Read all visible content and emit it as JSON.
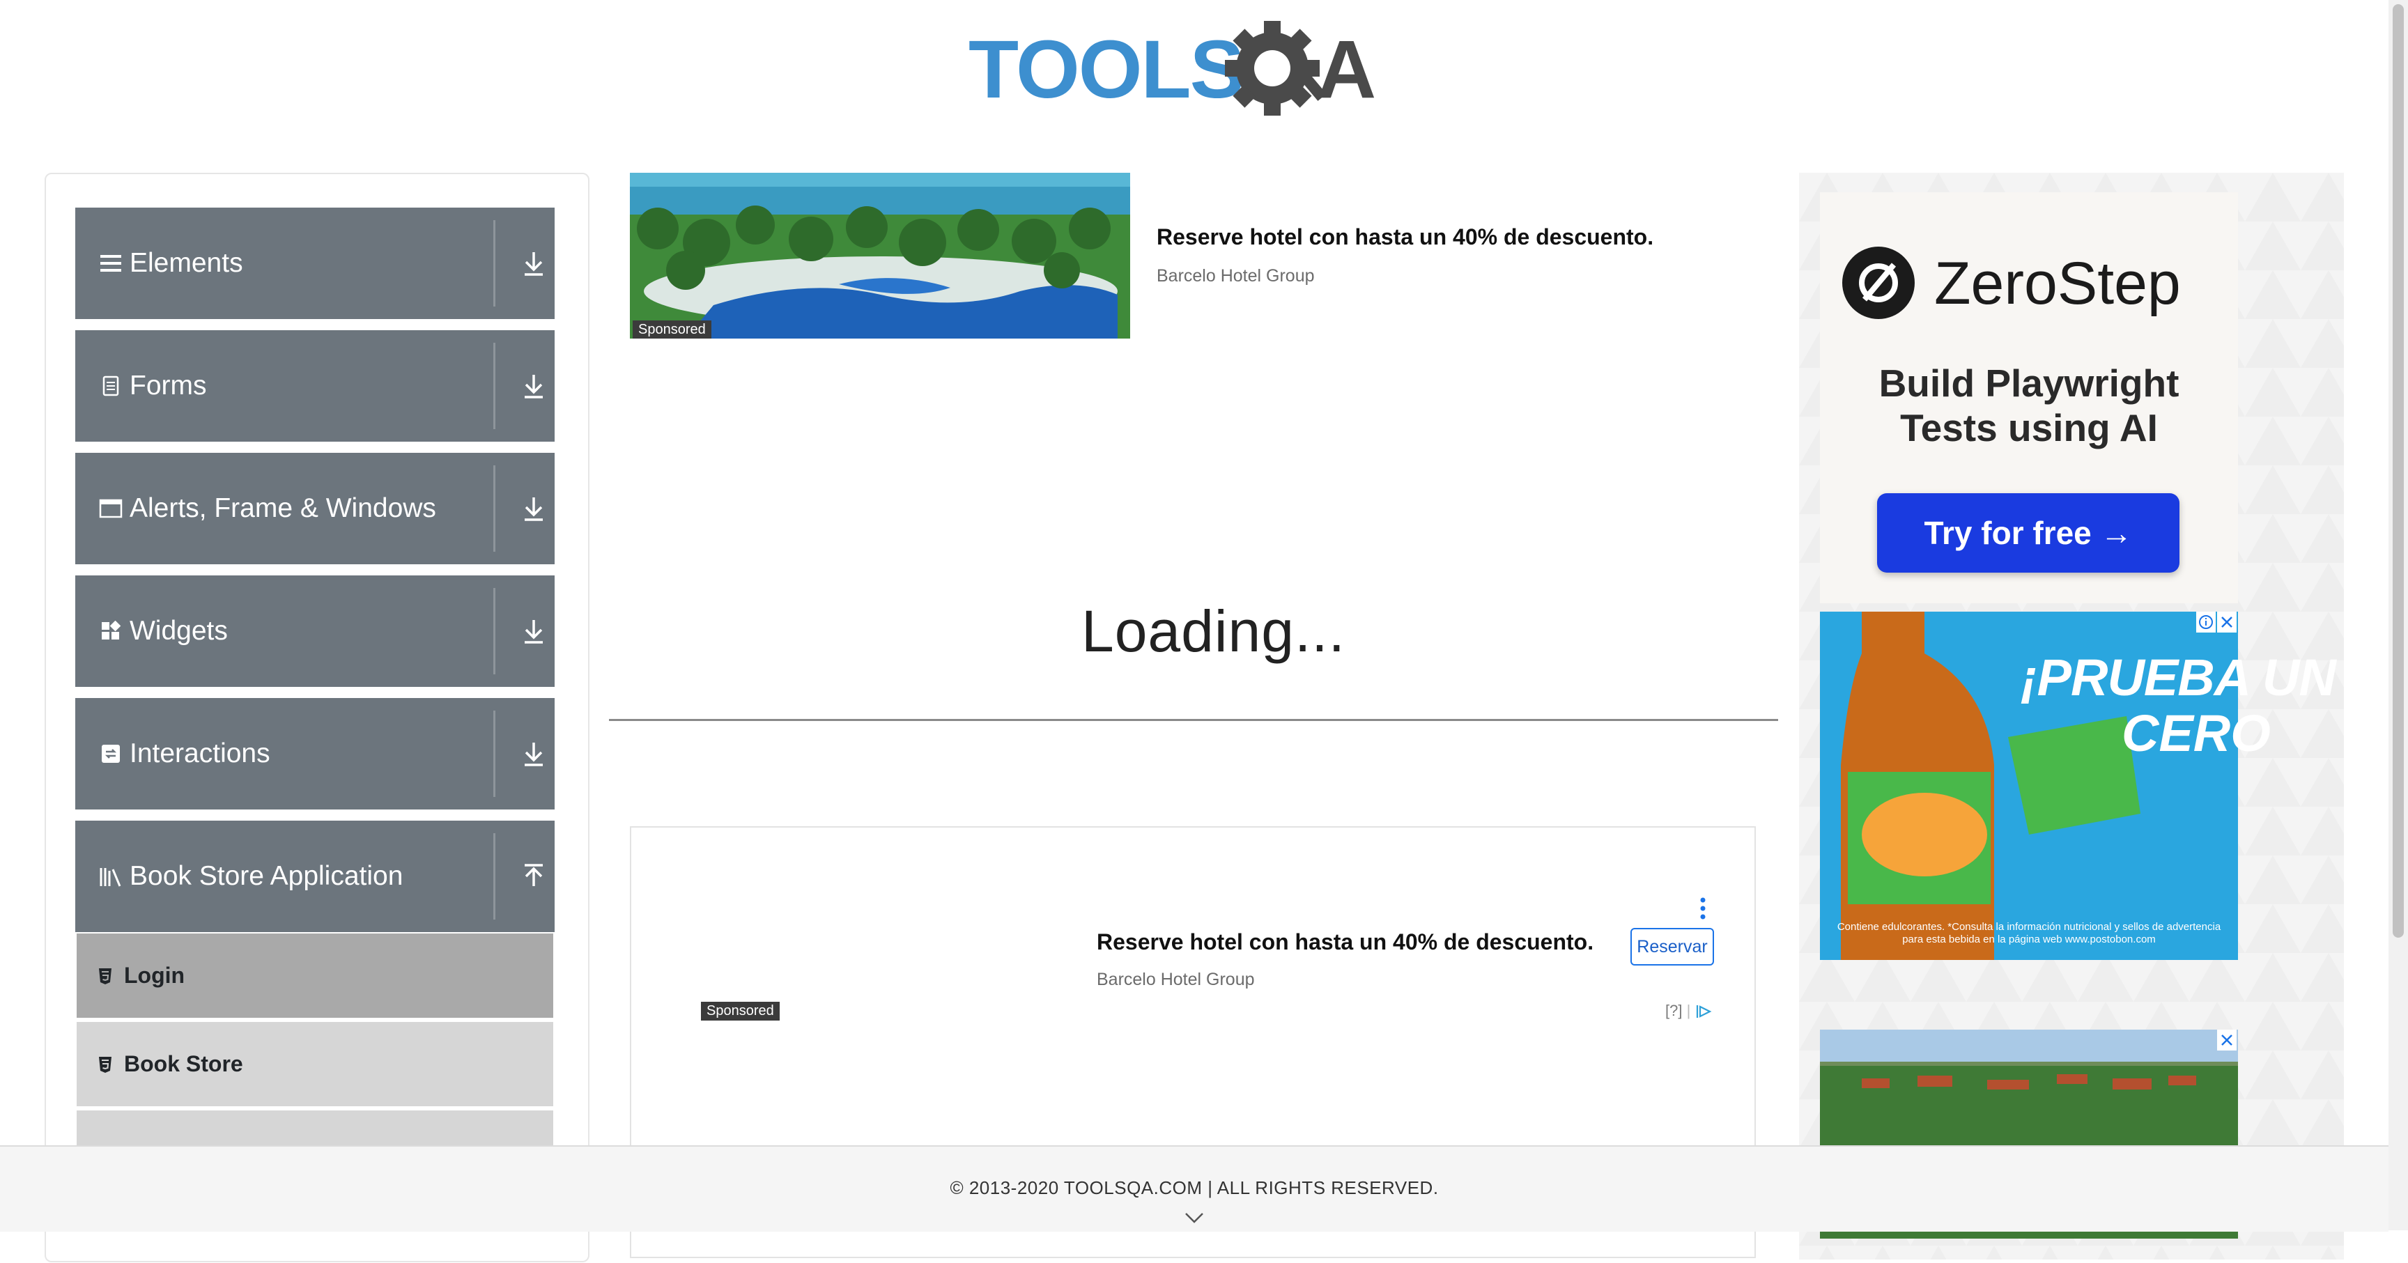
{
  "logo": {
    "text_tools": "TOOLS",
    "text_qa": "QA",
    "brand_blue": "#3d8fcf",
    "brand_dark": "#4a4a4a"
  },
  "sidebar": {
    "groups": [
      {
        "label": "Elements",
        "icon": "menu-lines-icon",
        "expanded": false
      },
      {
        "label": "Forms",
        "icon": "document-icon",
        "expanded": false
      },
      {
        "label": "Alerts, Frame & Windows",
        "icon": "window-icon",
        "expanded": false
      },
      {
        "label": "Widgets",
        "icon": "widgets-icon",
        "expanded": false
      },
      {
        "label": "Interactions",
        "icon": "interactions-icon",
        "expanded": false
      },
      {
        "label": "Book Store Application",
        "icon": "library-icon",
        "expanded": true
      }
    ],
    "book_store_items": [
      {
        "label": "Login",
        "active": true
      },
      {
        "label": "Book Store",
        "active": false
      },
      {
        "label": "",
        "active": false
      }
    ],
    "header_color": "#6c757d"
  },
  "top_ad": {
    "sponsored": "Sponsored",
    "title": "Reserve hotel con hasta un 40% de descuento.",
    "advertiser": "Barcelo Hotel Group"
  },
  "main": {
    "loading": "Loading..."
  },
  "bottom_ad": {
    "sponsored": "Sponsored",
    "title": "Reserve hotel con hasta un 40% de descuento.",
    "advertiser": "Barcelo Hotel Group",
    "cta": "Reservar",
    "choices": "[?]"
  },
  "right_ads": {
    "zerostep": {
      "brand": "ZeroStep",
      "headline_line1": "Build Playwright",
      "headline_line2": "Tests using AI",
      "cta": "Try for free →"
    },
    "drink": {
      "headline1": "¡PRUEBA UN",
      "headline2": "CERO",
      "disclaimer": "Contiene edulcorantes. *Consulta la información nutricional y sellos de advertencia para esta bebida en la página web www.postobon.com"
    }
  },
  "footer": {
    "text": "© 2013-2020 TOOLSQA.COM | ALL RIGHTS RESERVED."
  }
}
